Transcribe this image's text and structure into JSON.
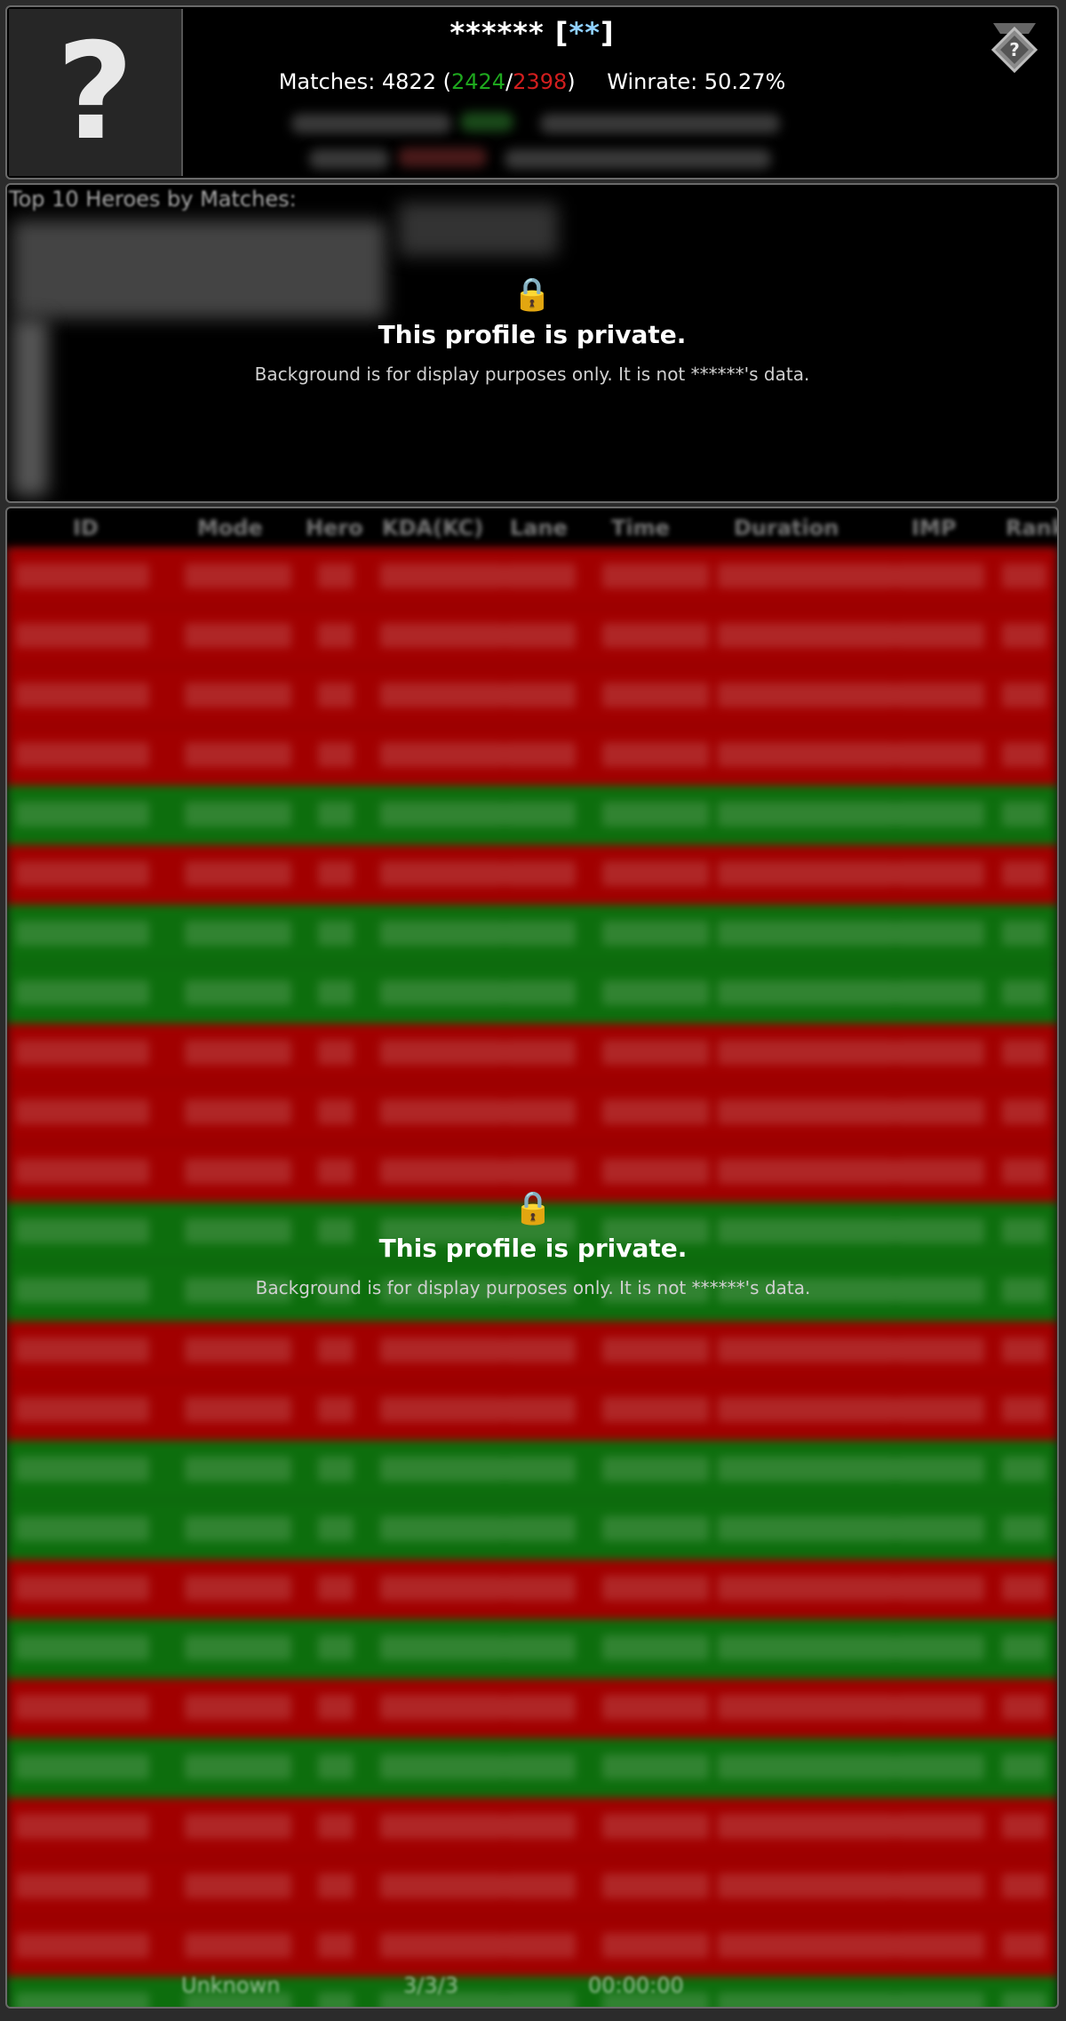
{
  "header": {
    "avatar_glyph": "?",
    "player_name": "******",
    "tag_open": "[",
    "tag": "**",
    "tag_close": "]",
    "matches_label": "Matches: 4822 (",
    "wins": "2424",
    "sep": "/",
    "losses": "2398",
    "close_paren": ")",
    "winrate_label": "Winrate: 50.27%",
    "rank_badge_icon": "unknown-rank-icon"
  },
  "heroes": {
    "title": "Top 10 Heroes by Matches:"
  },
  "private_notice": {
    "icon": "lock-icon",
    "lock_glyph": "🔒",
    "message": "This profile is private.",
    "subtext": "Background is for display purposes only. It is not ******'s data."
  },
  "table": {
    "columns": [
      "ID",
      "Mode",
      "Hero",
      "KDA(KC)",
      "Lane",
      "Time",
      "Duration",
      "IMP",
      "Rank"
    ],
    "row_results": [
      "loss",
      "loss",
      "loss",
      "loss",
      "win",
      "loss",
      "win",
      "win",
      "loss",
      "loss",
      "loss",
      "win",
      "win",
      "loss",
      "loss",
      "win",
      "win",
      "loss",
      "win",
      "loss",
      "win",
      "loss",
      "loss",
      "loss",
      "win"
    ],
    "last_row": {
      "mode": "Unknown",
      "kda": "3/3/3",
      "time": "00:00:00"
    }
  },
  "colors": {
    "win": "#0d6e0d",
    "loss": "#a10000",
    "tag": "#8fd0ff"
  }
}
